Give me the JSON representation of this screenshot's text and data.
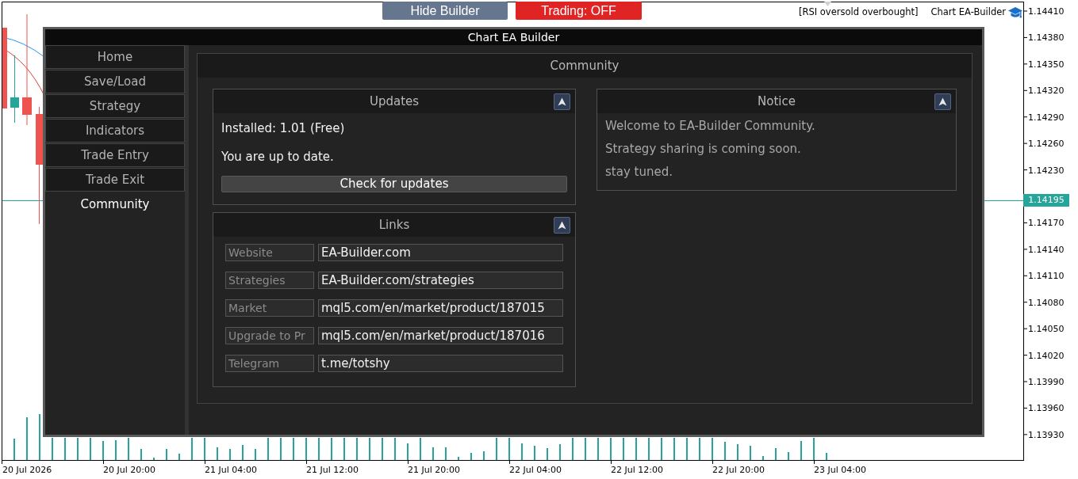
{
  "toolbar": {
    "hide_button": "Hide Builder",
    "trading": {
      "label": "Trading: OFF",
      "on": false
    }
  },
  "chart_header": {
    "indicator": "[RSI oversold overbought]",
    "expert": "Chart EA-Builder"
  },
  "chart": {
    "price_labels": [
      "1.14410",
      "1.14380",
      "1.14350",
      "1.14320",
      "1.14290",
      "1.14260",
      "1.14230",
      "1.14170",
      "1.14140",
      "1.14110",
      "1.14080",
      "1.14050",
      "1.14020",
      "1.13990",
      "1.13960",
      "1.13930"
    ],
    "current_price": "1.14195",
    "time_labels": [
      "20 Jul 2026",
      "20 Jul 20:00",
      "21 Jul 04:00",
      "21 Jul 12:00",
      "21 Jul 20:00",
      "22 Jul 04:00",
      "22 Jul 12:00",
      "22 Jul 20:00",
      "23 Jul 04:00"
    ]
  },
  "builder": {
    "title": "Chart EA Builder",
    "nav": [
      {
        "label": "Home",
        "selected": false
      },
      {
        "label": "Save/Load",
        "selected": false
      },
      {
        "label": "Strategy",
        "selected": false
      },
      {
        "label": "Indicators",
        "selected": false
      },
      {
        "label": "Trade Entry",
        "selected": false
      },
      {
        "label": "Trade Exit",
        "selected": false
      },
      {
        "label": "Community",
        "selected": true
      }
    ],
    "page": {
      "title": "Community",
      "updates": {
        "title": "Updates",
        "expanded": true,
        "installed": "Installed: 1.01 (Free)",
        "status": "You are up to date.",
        "button": "Check for updates"
      },
      "links": {
        "title": "Links",
        "expanded": true,
        "rows": [
          {
            "label": "Website",
            "value": "EA-Builder.com"
          },
          {
            "label": "Strategies",
            "value": "EA-Builder.com/strategies"
          },
          {
            "label": "Market",
            "value": "mql5.com/en/market/product/187015"
          },
          {
            "label": "Upgrade to Pr",
            "value": "mql5.com/en/market/product/187016"
          },
          {
            "label": "Telegram",
            "value": "t.me/totshy"
          }
        ]
      },
      "notice": {
        "title": "Notice",
        "expanded": true,
        "lines": [
          "Welcome to EA-Builder Community.",
          "Strategy sharing is coming soon.",
          "stay tuned."
        ]
      }
    }
  }
}
